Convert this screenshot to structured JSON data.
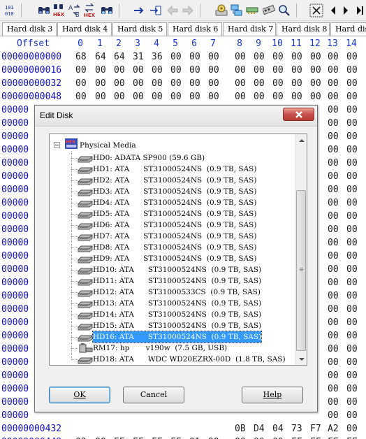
{
  "toolbar": {
    "icons": [
      "binary-010-icon",
      "binoculars-icon",
      "find-hex-icon",
      "replace-text-icon",
      "replace-hex-icon",
      "binoculars-next-icon",
      "arrow-right-icon",
      "goto-offset-icon",
      "back-icon",
      "forward-icon",
      "open-disk-icon",
      "disk-clone-icon",
      "ram-icon",
      "ram-icon-2",
      "search-icon",
      "tools-icon",
      "prev-icon",
      "next-icon",
      "next-icon-2"
    ]
  },
  "tabs": [
    "Hard disk 3",
    "Hard disk 4",
    "Hard disk 5",
    "Hard disk 6",
    "Hard disk 7",
    "Hard disk 8",
    "Hard disk"
  ],
  "hex": {
    "offset_label": "Offset",
    "columns": [
      "0",
      "1",
      "2",
      "3",
      "4",
      "5",
      "6",
      "7",
      "8",
      "9",
      "10",
      "11",
      "12",
      "13",
      "14"
    ],
    "rows": [
      {
        "offset": "00000000000",
        "bytes": [
          "68",
          "64",
          "64",
          "31",
          "36",
          "00",
          "00",
          "00",
          "00",
          "00",
          "00",
          "00",
          "00",
          "00",
          "00"
        ]
      },
      {
        "offset": "00000000016",
        "bytes": [
          "00",
          "00",
          "00",
          "00",
          "00",
          "00",
          "00",
          "00",
          "00",
          "00",
          "00",
          "00",
          "00",
          "00",
          "00"
        ]
      },
      {
        "offset": "00000000032",
        "bytes": [
          "00",
          "00",
          "00",
          "00",
          "00",
          "00",
          "00",
          "00",
          "00",
          "00",
          "00",
          "00",
          "00",
          "00",
          "00"
        ]
      },
      {
        "offset": "00000000048",
        "bytes": [
          "00",
          "00",
          "00",
          "00",
          "00",
          "00",
          "00",
          "00",
          "00",
          "00",
          "00",
          "00",
          "00",
          "00",
          "00"
        ]
      },
      {
        "offset": "00000",
        "bytes": [
          "",
          "",
          "",
          "",
          "",
          "",
          "",
          "",
          "",
          "",
          "",
          "",
          "",
          "00",
          "00"
        ]
      },
      {
        "offset": "00000",
        "bytes": [
          "",
          "",
          "",
          "",
          "",
          "",
          "",
          "",
          "",
          "",
          "",
          "",
          "",
          "00",
          "00"
        ]
      },
      {
        "offset": "00000",
        "bytes": [
          "",
          "",
          "",
          "",
          "",
          "",
          "",
          "",
          "",
          "",
          "",
          "",
          "",
          "00",
          "00"
        ]
      },
      {
        "offset": "00000",
        "bytes": [
          "",
          "",
          "",
          "",
          "",
          "",
          "",
          "",
          "",
          "",
          "",
          "",
          "",
          "00",
          "00"
        ]
      },
      {
        "offset": "00000",
        "bytes": [
          "",
          "",
          "",
          "",
          "",
          "",
          "",
          "",
          "",
          "",
          "",
          "",
          "",
          "00",
          "00"
        ]
      },
      {
        "offset": "00000",
        "bytes": [
          "",
          "",
          "",
          "",
          "",
          "",
          "",
          "",
          "",
          "",
          "",
          "",
          "",
          "00",
          "00"
        ]
      },
      {
        "offset": "00000",
        "bytes": [
          "",
          "",
          "",
          "",
          "",
          "",
          "",
          "",
          "",
          "",
          "",
          "",
          "",
          "00",
          "00"
        ]
      },
      {
        "offset": "00000",
        "bytes": [
          "",
          "",
          "",
          "",
          "",
          "",
          "",
          "",
          "",
          "",
          "",
          "",
          "",
          "00",
          "00"
        ]
      },
      {
        "offset": "00000",
        "bytes": [
          "",
          "",
          "",
          "",
          "",
          "",
          "",
          "",
          "",
          "",
          "",
          "",
          "",
          "00",
          "00"
        ]
      },
      {
        "offset": "00000",
        "bytes": [
          "",
          "",
          "",
          "",
          "",
          "",
          "",
          "",
          "",
          "",
          "",
          "",
          "",
          "00",
          "00"
        ]
      },
      {
        "offset": "00000",
        "bytes": [
          "",
          "",
          "",
          "",
          "",
          "",
          "",
          "",
          "",
          "",
          "",
          "",
          "",
          "00",
          "00"
        ]
      },
      {
        "offset": "00000",
        "bytes": [
          "",
          "",
          "",
          "",
          "",
          "",
          "",
          "",
          "",
          "",
          "",
          "",
          "",
          "00",
          "00"
        ]
      },
      {
        "offset": "00000",
        "bytes": [
          "",
          "",
          "",
          "",
          "",
          "",
          "",
          "",
          "",
          "",
          "",
          "",
          "",
          "00",
          "00"
        ]
      },
      {
        "offset": "00000",
        "bytes": [
          "",
          "",
          "",
          "",
          "",
          "",
          "",
          "",
          "",
          "",
          "",
          "",
          "",
          "00",
          "00"
        ]
      },
      {
        "offset": "00000",
        "bytes": [
          "",
          "",
          "",
          "",
          "",
          "",
          "",
          "",
          "",
          "",
          "",
          "",
          "",
          "00",
          "00"
        ]
      },
      {
        "offset": "00000",
        "bytes": [
          "",
          "",
          "",
          "",
          "",
          "",
          "",
          "",
          "",
          "",
          "",
          "",
          "",
          "00",
          "00"
        ]
      },
      {
        "offset": "00000",
        "bytes": [
          "",
          "",
          "",
          "",
          "",
          "",
          "",
          "",
          "",
          "",
          "",
          "",
          "",
          "00",
          "00"
        ]
      },
      {
        "offset": "00000",
        "bytes": [
          "",
          "",
          "",
          "",
          "",
          "",
          "",
          "",
          "",
          "",
          "",
          "",
          "",
          "00",
          "00"
        ]
      },
      {
        "offset": "00000",
        "bytes": [
          "",
          "",
          "",
          "",
          "",
          "",
          "",
          "",
          "",
          "",
          "",
          "",
          "",
          "00",
          "00"
        ]
      },
      {
        "offset": "00000",
        "bytes": [
          "",
          "",
          "",
          "",
          "",
          "",
          "",
          "",
          "",
          "",
          "",
          "",
          "",
          "00",
          "00"
        ]
      },
      {
        "offset": "00000",
        "bytes": [
          "",
          "",
          "",
          "",
          "",
          "",
          "",
          "",
          "",
          "",
          "",
          "",
          "",
          "00",
          "00"
        ]
      },
      {
        "offset": "00000",
        "bytes": [
          "",
          "",
          "",
          "",
          "",
          "",
          "",
          "",
          "",
          "",
          "",
          "",
          "",
          "00",
          "00"
        ]
      },
      {
        "offset": "00000",
        "bytes": [
          "",
          "",
          "",
          "",
          "",
          "",
          "",
          "",
          "",
          "",
          "",
          "",
          "",
          "00",
          "00"
        ]
      },
      {
        "offset": "00000",
        "bytes": [
          "",
          "",
          "",
          "",
          "",
          "",
          "",
          "",
          "",
          "",
          "",
          "",
          "",
          "00",
          "00"
        ]
      },
      {
        "offset": "00000000432",
        "bytes": [
          "",
          "",
          "",
          "",
          "",
          "",
          "",
          "",
          "0B",
          "D4",
          "04",
          "73",
          "F7",
          "A2",
          "00"
        ]
      },
      {
        "offset": "00000000448",
        "bytes": [
          "02",
          "00",
          "EE",
          "FF",
          "FF",
          "FF",
          "01",
          "00",
          "00",
          "00",
          "00",
          "FF",
          "FF",
          "FF",
          "FF"
        ]
      }
    ]
  },
  "dialog": {
    "title": "Edit Disk",
    "root_label": "Physical Media",
    "root_icon": "hex-disk-icon",
    "items": [
      {
        "label": "HD0: ADATA SP900 (59.6 GB)",
        "icon": "hard-disk-icon"
      },
      {
        "label": "HD1: ATA      ST31000524NS  (0.9 TB, SAS)",
        "icon": "hard-disk-icon"
      },
      {
        "label": "HD2: ATA      ST31000524NS  (0.9 TB, SAS)",
        "icon": "hard-disk-icon"
      },
      {
        "label": "HD3: ATA      ST31000524NS  (0.9 TB, SAS)",
        "icon": "hard-disk-icon"
      },
      {
        "label": "HD4: ATA      ST31000524NS  (0.9 TB, SAS)",
        "icon": "hard-disk-icon"
      },
      {
        "label": "HD5: ATA      ST31000524NS  (0.9 TB, SAS)",
        "icon": "hard-disk-icon"
      },
      {
        "label": "HD6: ATA      ST31000524NS  (0.9 TB, SAS)",
        "icon": "hard-disk-icon"
      },
      {
        "label": "HD7: ATA      ST31000524NS  (0.9 TB, SAS)",
        "icon": "hard-disk-icon"
      },
      {
        "label": "HD8: ATA      ST31000524NS  (0.9 TB, SAS)",
        "icon": "hard-disk-icon"
      },
      {
        "label": "HD9: ATA      ST31000524NS  (0.9 TB, SAS)",
        "icon": "hard-disk-icon"
      },
      {
        "label": "HD10: ATA      ST31000524NS  (0.9 TB, SAS)",
        "icon": "hard-disk-icon"
      },
      {
        "label": "HD11: ATA      ST31000524NS  (0.9 TB, SAS)",
        "icon": "hard-disk-icon"
      },
      {
        "label": "HD12: ATA      ST31000533CS  (0.9 TB, SAS)",
        "icon": "hard-disk-icon"
      },
      {
        "label": "HD13: ATA      ST31000524NS  (0.9 TB, SAS)",
        "icon": "hard-disk-icon"
      },
      {
        "label": "HD14: ATA      ST31000524NS  (0.9 TB, SAS)",
        "icon": "hard-disk-icon"
      },
      {
        "label": "HD15: ATA      ST31000524NS  (0.9 TB, SAS)",
        "icon": "hard-disk-icon"
      },
      {
        "label": "HD16: ATA      ST31000524NS  (0.9 TB, SAS)",
        "icon": "hard-disk-icon",
        "selected": true
      },
      {
        "label": "RM17: hp       v190w  (7.5 GB, USB)",
        "icon": "usb-drive-icon"
      },
      {
        "label": "HD18: ATA      WDC WD20EZRX-00D  (1.8 TB, SAS)",
        "icon": "hard-disk-icon"
      }
    ],
    "ok_label": "OK",
    "cancel_label": "Cancel",
    "help_label": "Help"
  },
  "colors": {
    "offset_blue": "#1010c8",
    "selection": "#3399ff",
    "close_red": "#c75050"
  }
}
